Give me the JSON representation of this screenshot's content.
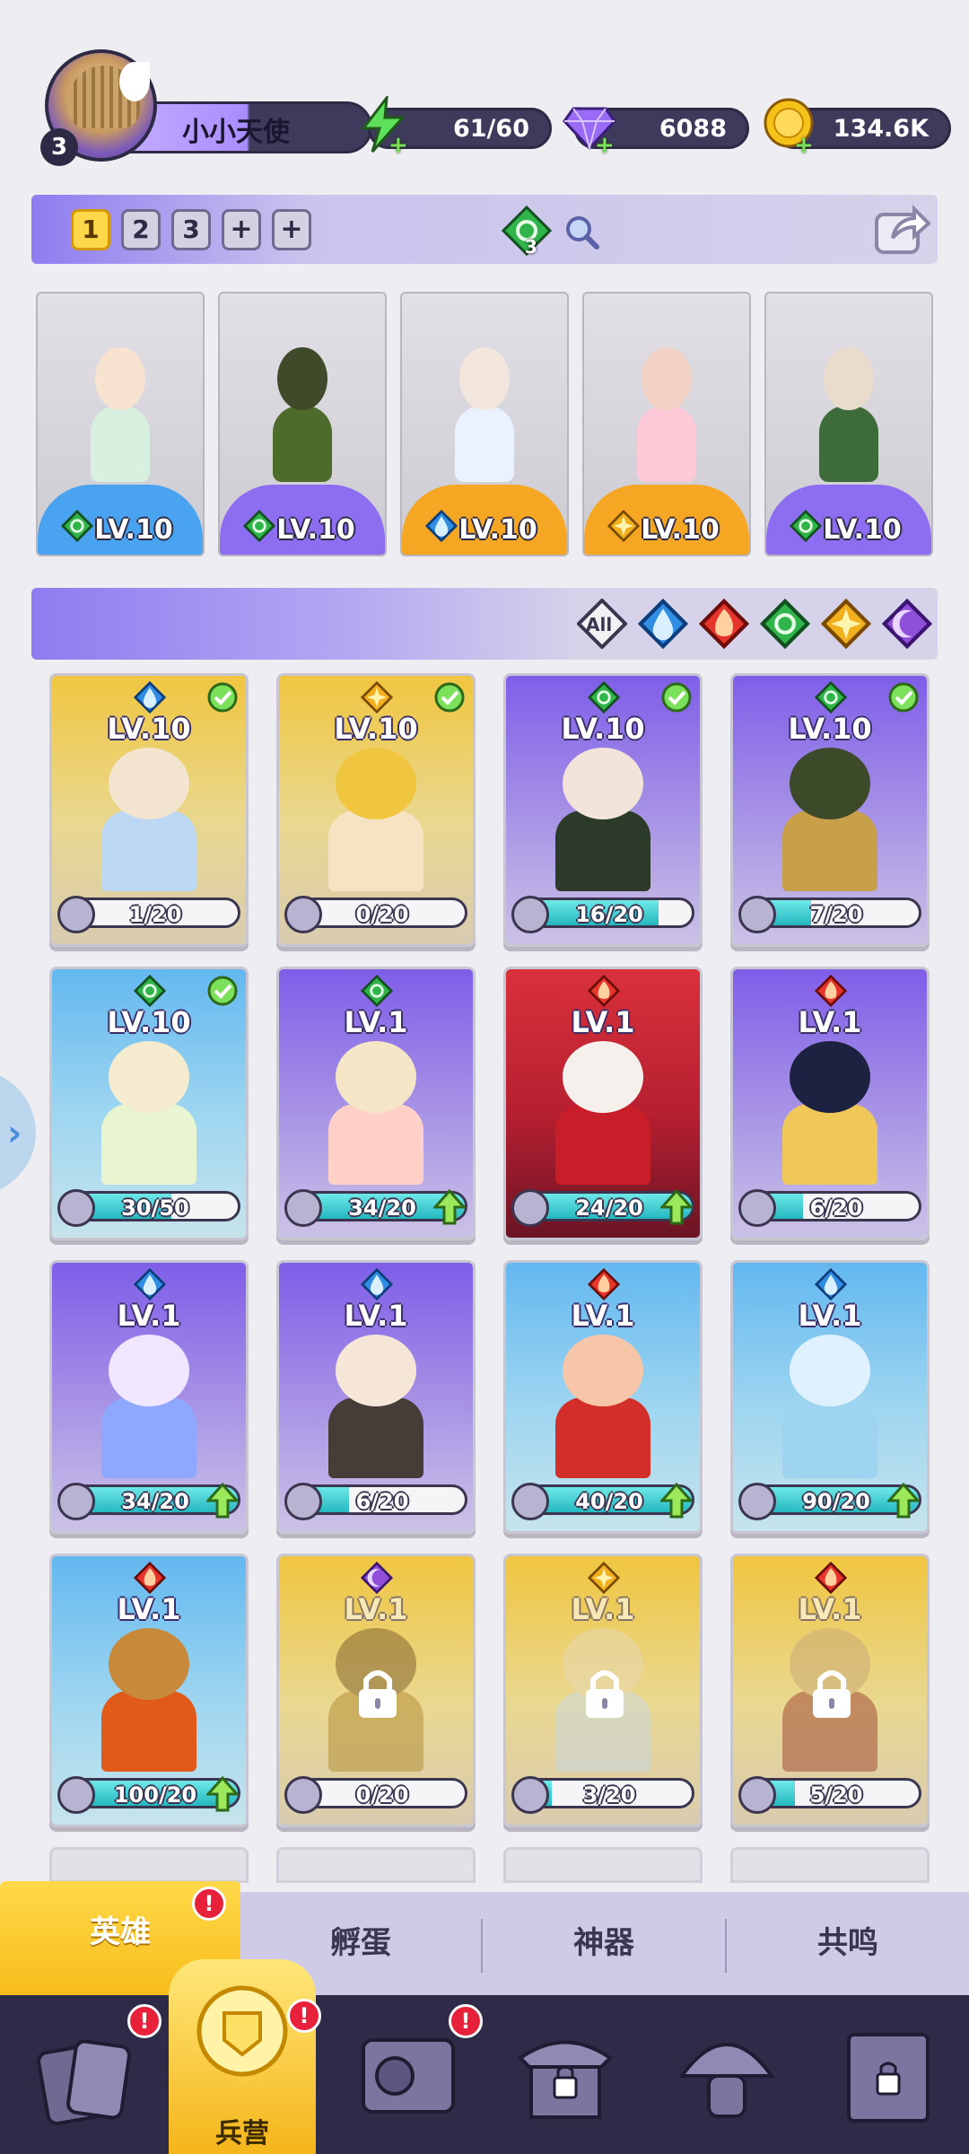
{
  "player": {
    "level": "3",
    "name": "小小天使"
  },
  "resources": {
    "energy": {
      "icon": "lightning-icon",
      "value": "61/60"
    },
    "gems": {
      "icon": "gem-icon",
      "value": "6088"
    },
    "gold": {
      "icon": "coin-icon",
      "value": "134.6K"
    }
  },
  "team_tabs": [
    "1",
    "2",
    "3",
    "+",
    "+"
  ],
  "team_center": {
    "badge": "3"
  },
  "lineup": [
    {
      "level": "LV.10",
      "element": "wind",
      "footer_color": "#4aa3f0",
      "stars": "★★"
    },
    {
      "level": "LV.10",
      "element": "wind",
      "footer_color": "#8d6df0",
      "stars": ""
    },
    {
      "level": "LV.10",
      "element": "water",
      "footer_color": "#f5a623",
      "stars": ""
    },
    {
      "level": "LV.10",
      "element": "light",
      "footer_color": "#f5a623",
      "stars": ""
    },
    {
      "level": "LV.10",
      "element": "wind",
      "footer_color": "#8d6df0",
      "stars": ""
    }
  ],
  "filters": {
    "all_label": "All",
    "elements": [
      "water",
      "fire",
      "wind",
      "light",
      "dark"
    ]
  },
  "heroes": [
    {
      "level": "LV.10",
      "element": "water",
      "bg": "gold",
      "checked": true,
      "progress": "1/20",
      "ratio": 0.05,
      "upgrade": false,
      "locked": false
    },
    {
      "level": "LV.10",
      "element": "light",
      "bg": "gold",
      "checked": true,
      "progress": "0/20",
      "ratio": 0,
      "upgrade": false,
      "locked": false
    },
    {
      "level": "LV.10",
      "element": "wind",
      "bg": "purple",
      "checked": true,
      "progress": "16/20",
      "ratio": 0.8,
      "upgrade": false,
      "locked": false
    },
    {
      "level": "LV.10",
      "element": "wind",
      "bg": "purple",
      "checked": true,
      "progress": "7/20",
      "ratio": 0.35,
      "upgrade": false,
      "locked": false
    },
    {
      "level": "LV.10",
      "element": "wind",
      "bg": "blue",
      "checked": true,
      "progress": "30/50",
      "ratio": 0.6,
      "upgrade": false,
      "locked": false
    },
    {
      "level": "LV.1",
      "element": "wind",
      "bg": "purple",
      "checked": false,
      "progress": "34/20",
      "ratio": 1,
      "upgrade": true,
      "locked": false
    },
    {
      "level": "LV.1",
      "element": "fire",
      "bg": "red",
      "checked": false,
      "progress": "24/20",
      "ratio": 1,
      "upgrade": true,
      "locked": false
    },
    {
      "level": "LV.1",
      "element": "fire",
      "bg": "purple",
      "checked": false,
      "progress": "6/20",
      "ratio": 0.3,
      "upgrade": false,
      "locked": false
    },
    {
      "level": "LV.1",
      "element": "water",
      "bg": "purple",
      "checked": false,
      "progress": "34/20",
      "ratio": 1,
      "upgrade": true,
      "locked": false
    },
    {
      "level": "LV.1",
      "element": "water",
      "bg": "purple",
      "checked": false,
      "progress": "6/20",
      "ratio": 0.3,
      "upgrade": false,
      "locked": false
    },
    {
      "level": "LV.1",
      "element": "fire",
      "bg": "blue",
      "checked": false,
      "progress": "40/20",
      "ratio": 1,
      "upgrade": true,
      "locked": false
    },
    {
      "level": "LV.1",
      "element": "water",
      "bg": "blue",
      "checked": false,
      "progress": "90/20",
      "ratio": 1,
      "upgrade": true,
      "locked": false
    },
    {
      "level": "LV.1",
      "element": "fire",
      "bg": "blue",
      "checked": false,
      "progress": "100/20",
      "ratio": 1,
      "upgrade": true,
      "locked": false
    },
    {
      "level": "LV.1",
      "element": "dark",
      "bg": "gold",
      "checked": false,
      "progress": "0/20",
      "ratio": 0,
      "upgrade": false,
      "locked": true
    },
    {
      "level": "LV.1",
      "element": "light",
      "bg": "gold",
      "checked": false,
      "progress": "3/20",
      "ratio": 0.15,
      "upgrade": false,
      "locked": true
    },
    {
      "level": "LV.1",
      "element": "fire",
      "bg": "gold",
      "checked": false,
      "progress": "5/20",
      "ratio": 0.25,
      "upgrade": false,
      "locked": true
    }
  ],
  "subtabs": [
    {
      "label": "英雄",
      "active": true,
      "alert": true
    },
    {
      "label": "孵蛋",
      "active": false,
      "alert": false
    },
    {
      "label": "神器",
      "active": false,
      "alert": false
    },
    {
      "label": "共鸣",
      "active": false,
      "alert": false
    }
  ],
  "nav": [
    {
      "name": "cards",
      "label": "",
      "alert": true,
      "locked": false
    },
    {
      "name": "barracks",
      "label": "兵营",
      "alert": true,
      "locked": false,
      "active": true
    },
    {
      "name": "map",
      "label": "",
      "alert": true,
      "locked": false
    },
    {
      "name": "shop",
      "label": "",
      "alert": false,
      "locked": true
    },
    {
      "name": "mushroom",
      "label": "",
      "alert": false,
      "locked": false
    },
    {
      "name": "guild",
      "label": "",
      "alert": false,
      "locked": true
    }
  ],
  "colors": {
    "water": "#2f8de4",
    "fire": "#e8352c",
    "wind": "#2fb54a",
    "light": "#f2b01e",
    "dark": "#8f4fd8"
  }
}
